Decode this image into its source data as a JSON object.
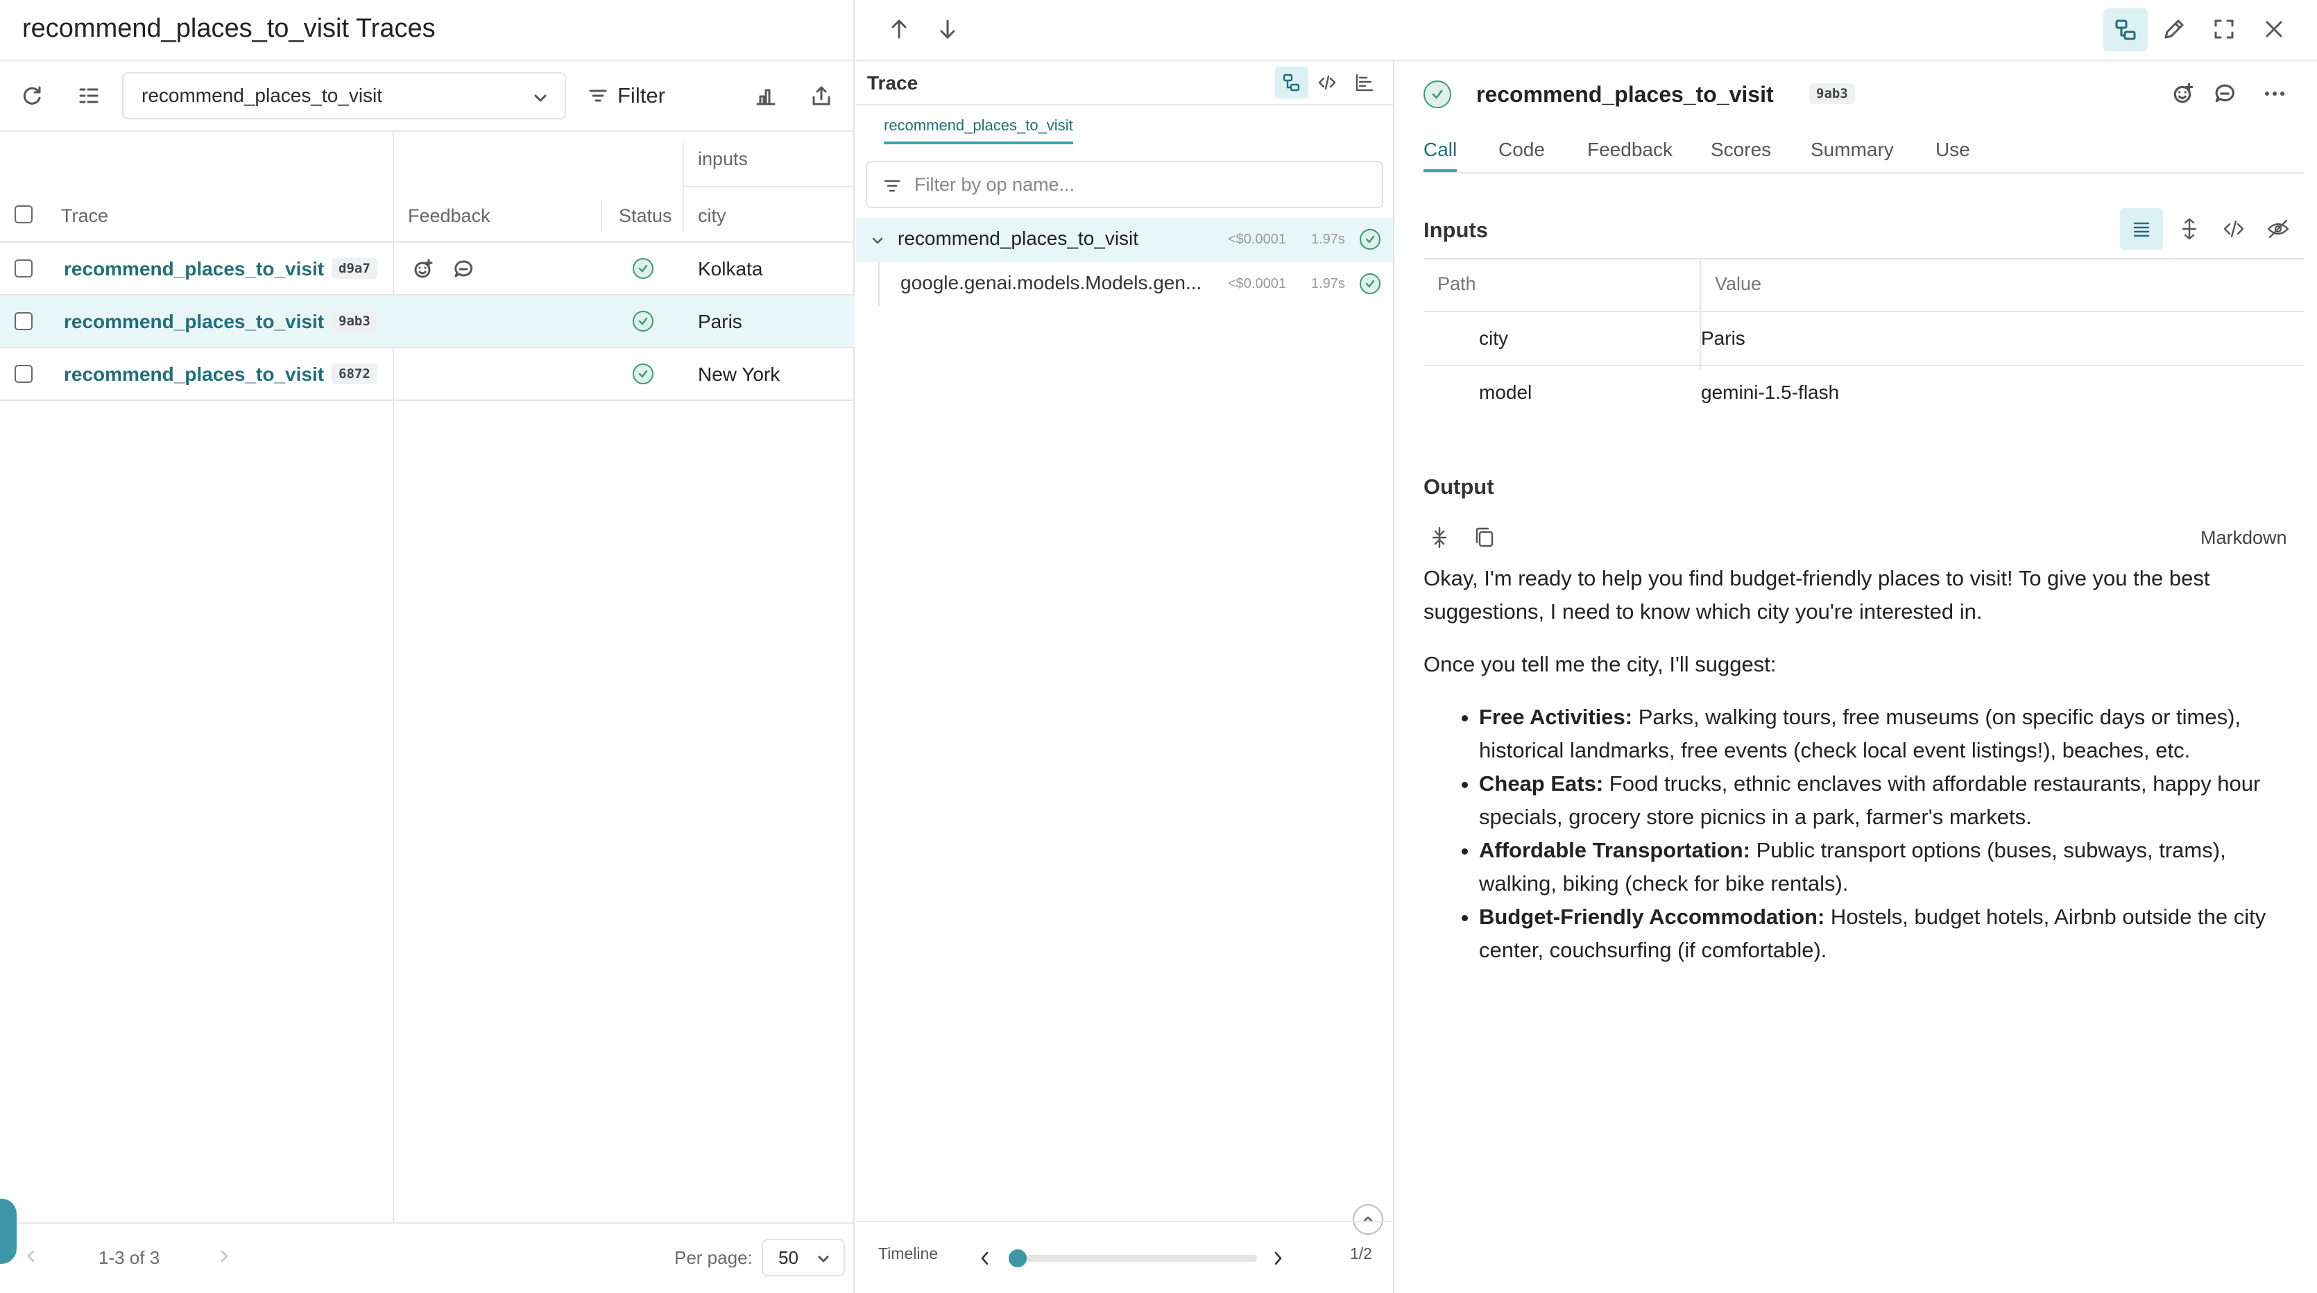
{
  "left_panel": {
    "title": "recommend_places_to_visit Traces",
    "op_select_value": "recommend_places_to_visit",
    "filter_label": "Filter",
    "table": {
      "group_header": "inputs",
      "columns": [
        "Trace",
        "Feedback",
        "Status",
        "city"
      ],
      "rows": [
        {
          "trace": "recommend_places_to_visit",
          "id": "d9a7",
          "city": "Kolkata",
          "selected": false
        },
        {
          "trace": "recommend_places_to_visit",
          "id": "9ab3",
          "city": "Paris",
          "selected": true
        },
        {
          "trace": "recommend_places_to_visit",
          "id": "6872",
          "city": "New York",
          "selected": false
        }
      ]
    },
    "pagination": {
      "range": "1-3 of 3",
      "per_page_label": "Per page:",
      "per_page_value": "50"
    }
  },
  "trace_panel": {
    "title": "Trace",
    "tab": "recommend_places_to_visit",
    "filter_placeholder": "Filter by op name...",
    "tree": [
      {
        "name": "recommend_places_to_visit",
        "cost": "<$0.0001",
        "duration": "1.97s"
      },
      {
        "name": "google.genai.models.Models.gen...",
        "cost": "<$0.0001",
        "duration": "1.97s"
      }
    ],
    "timeline": {
      "label": "Timeline",
      "page": "1/2",
      "position": 0.0
    }
  },
  "detail_panel": {
    "call_name": "recommend_places_to_visit",
    "call_id": "9ab3",
    "tabs": [
      "Call",
      "Code",
      "Feedback",
      "Scores",
      "Summary",
      "Use"
    ],
    "active_tab": "Call",
    "inputs": {
      "header": "Inputs",
      "path_label": "Path",
      "value_label": "Value",
      "rows": [
        {
          "path": "city",
          "value": "Paris"
        },
        {
          "path": "model",
          "value": "gemini-1.5-flash"
        }
      ]
    },
    "output": {
      "header": "Output",
      "format_label": "Markdown",
      "intro": "Okay, I'm ready to help you find budget-friendly places to visit! To give you the best suggestions, I need to know which city you're interested in.",
      "lead": "Once you tell me the city, I'll suggest:",
      "items": [
        {
          "title": "Free Activities:",
          "text": " Parks, walking tours, free museums (on specific days or times), historical landmarks, free events (check local event listings!), beaches, etc."
        },
        {
          "title": "Cheap Eats:",
          "text": " Food trucks, ethnic enclaves with affordable restaurants, happy hour specials, grocery store picnics in a park, farmer's markets."
        },
        {
          "title": "Affordable Transportation:",
          "text": " Public transport options (buses, subways, trams), walking, biking (check for bike rentals)."
        },
        {
          "title": "Budget-Friendly Accommodation:",
          "text": " Hostels, budget hotels, Airbnb outside the city center, couchsurfing (if comfortable)."
        }
      ]
    }
  },
  "colors": {
    "accent": "#1f6f7a",
    "selection": "#e9f6f7",
    "success": "#3d9a78"
  }
}
